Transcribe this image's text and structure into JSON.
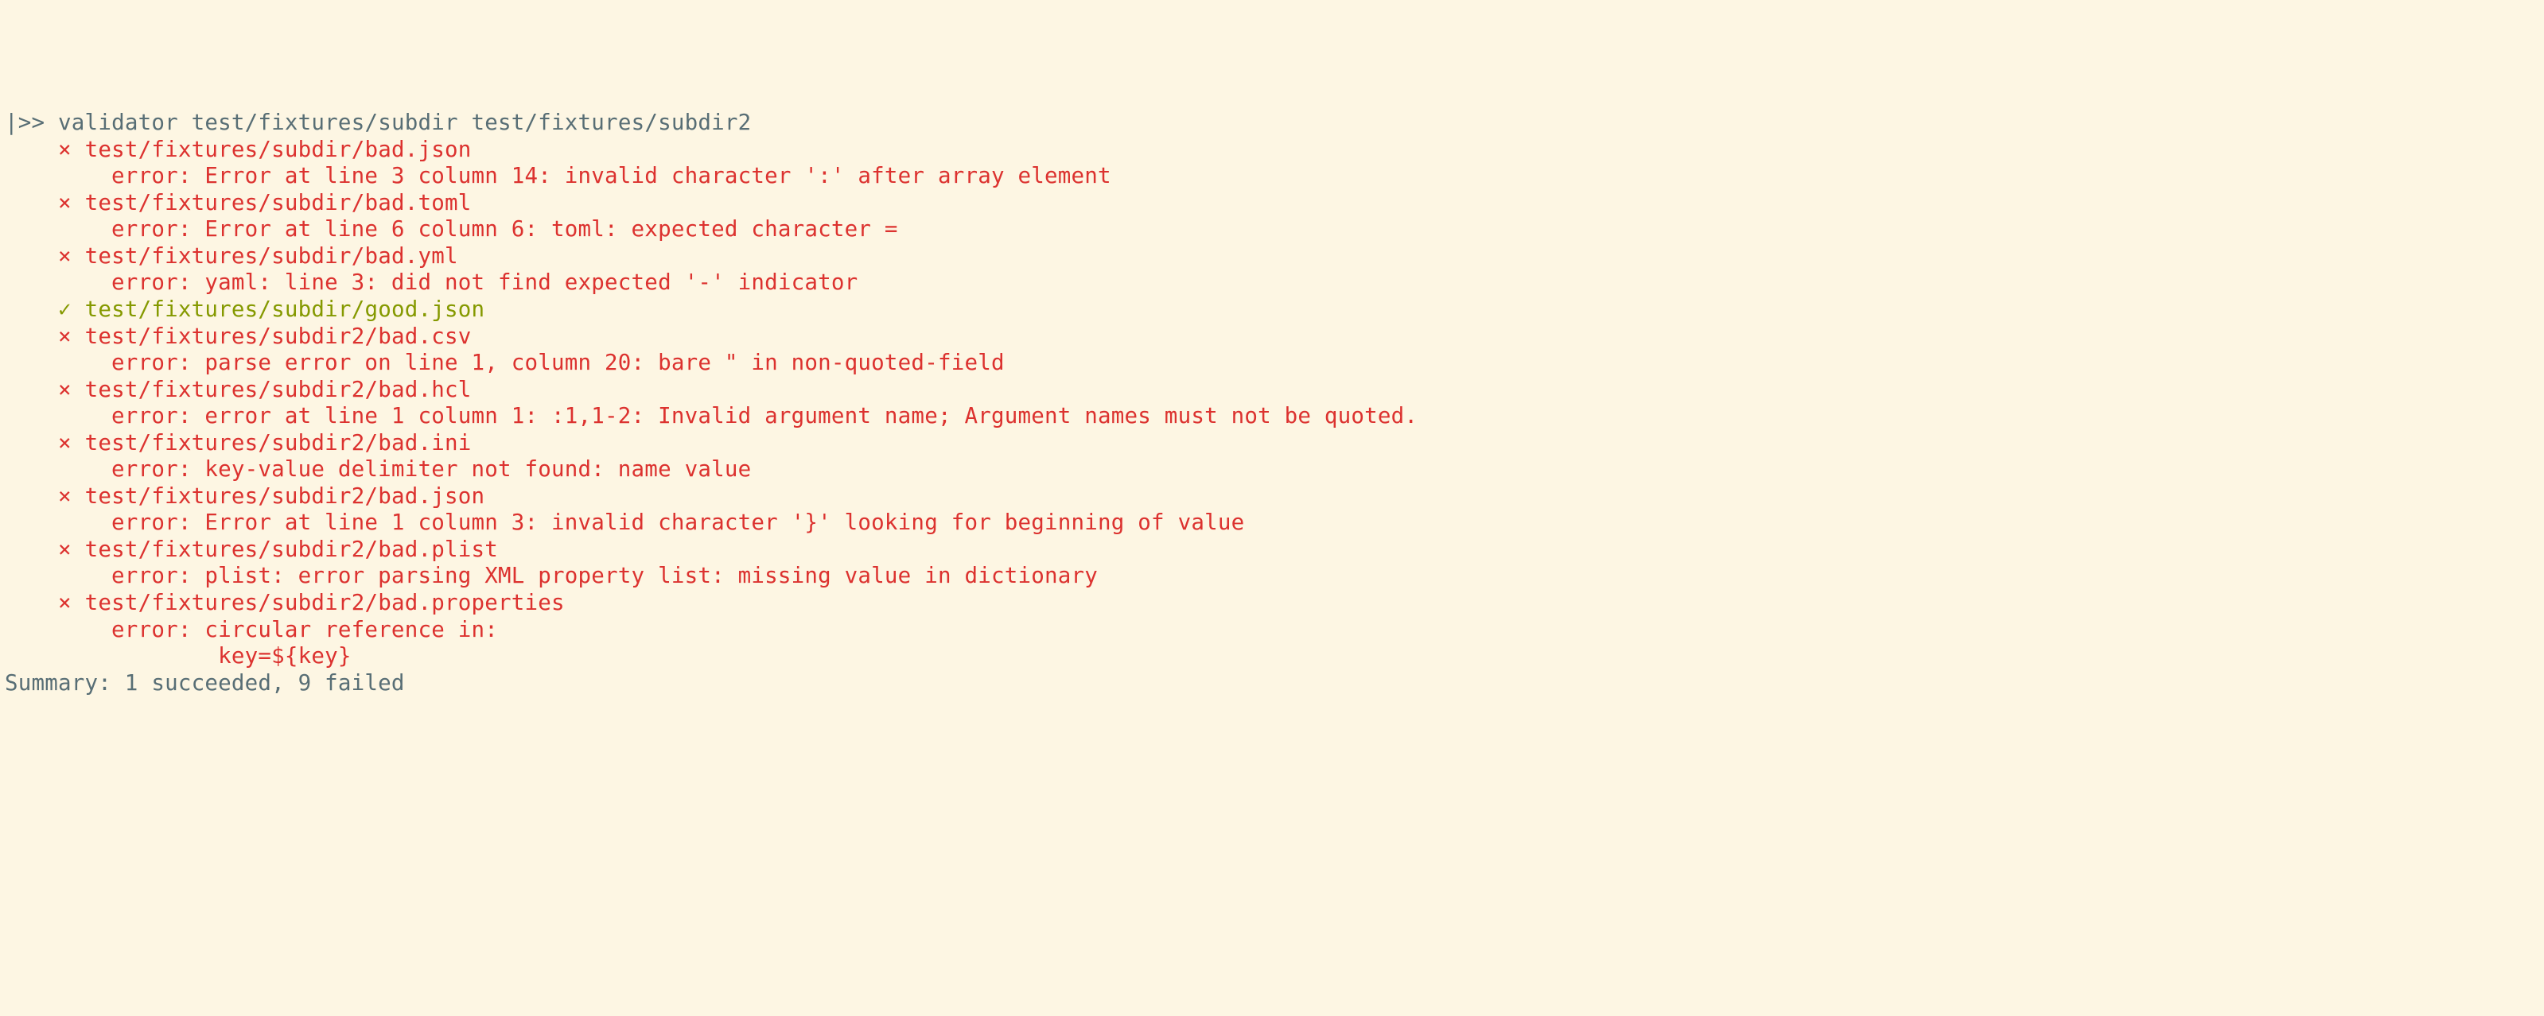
{
  "prompt": ">> ",
  "command": "validator test/fixtures/subdir test/fixtures/subdir2",
  "cursor": "|",
  "indent_item": "    ",
  "indent_error": "        ",
  "marks": {
    "fail": "×",
    "pass": "✓"
  },
  "results": [
    {
      "status": "fail",
      "path": "test/fixtures/subdir/bad.json",
      "errors": [
        "error: Error at line 3 column 14: invalid character ':' after array element"
      ]
    },
    {
      "status": "fail",
      "path": "test/fixtures/subdir/bad.toml",
      "errors": [
        "error: Error at line 6 column 6: toml: expected character ="
      ]
    },
    {
      "status": "fail",
      "path": "test/fixtures/subdir/bad.yml",
      "errors": [
        "error: yaml: line 3: did not find expected '-' indicator"
      ]
    },
    {
      "status": "pass",
      "path": "test/fixtures/subdir/good.json",
      "errors": []
    },
    {
      "status": "fail",
      "path": "test/fixtures/subdir2/bad.csv",
      "errors": [
        "error: parse error on line 1, column 20: bare \" in non-quoted-field"
      ]
    },
    {
      "status": "fail",
      "path": "test/fixtures/subdir2/bad.hcl",
      "errors": [
        "error: error at line 1 column 1: :1,1-2: Invalid argument name; Argument names must not be quoted."
      ]
    },
    {
      "status": "fail",
      "path": "test/fixtures/subdir2/bad.ini",
      "errors": [
        "error: key-value delimiter not found: name value"
      ]
    },
    {
      "status": "fail",
      "path": "test/fixtures/subdir2/bad.json",
      "errors": [
        "error: Error at line 1 column 3: invalid character '}' looking for beginning of value"
      ]
    },
    {
      "status": "fail",
      "path": "test/fixtures/subdir2/bad.plist",
      "errors": [
        "error: plist: error parsing XML property list: missing value in dictionary"
      ]
    },
    {
      "status": "fail",
      "path": "test/fixtures/subdir2/bad.properties",
      "errors": [
        "error: circular reference in:",
        "        key=${key}"
      ]
    }
  ],
  "summary": "Summary: 1 succeeded, 9 failed"
}
